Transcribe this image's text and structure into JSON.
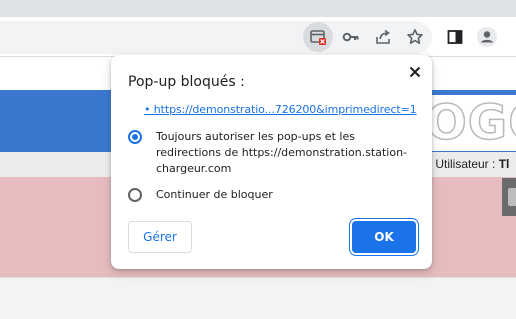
{
  "toolbar": {
    "icons": [
      "popup-blocked-icon",
      "key-icon",
      "share-icon",
      "bookmark-star-icon",
      "side-panel-icon",
      "profile-icon"
    ],
    "popup_blocked_badge_color": "#d93025"
  },
  "page": {
    "logo_text": "OGO",
    "user_label": "- Utilisateur : ",
    "user_name": "Tl"
  },
  "popup": {
    "title": "Pop-up bloqués :",
    "blocked_link": "https://demonstratio...726200&imprimedirect=1",
    "options": [
      {
        "label": "Toujours autoriser les pop-ups et les redirections de https://demonstration.station-chargeur.com",
        "checked": true
      },
      {
        "label": "Continuer de bloquer",
        "checked": false
      }
    ],
    "manage_button": "Gérer",
    "ok_button": "OK"
  },
  "colors": {
    "accent": "#1a73e8",
    "page_blue": "#3a78d0",
    "page_pink": "#e6bcbe"
  }
}
